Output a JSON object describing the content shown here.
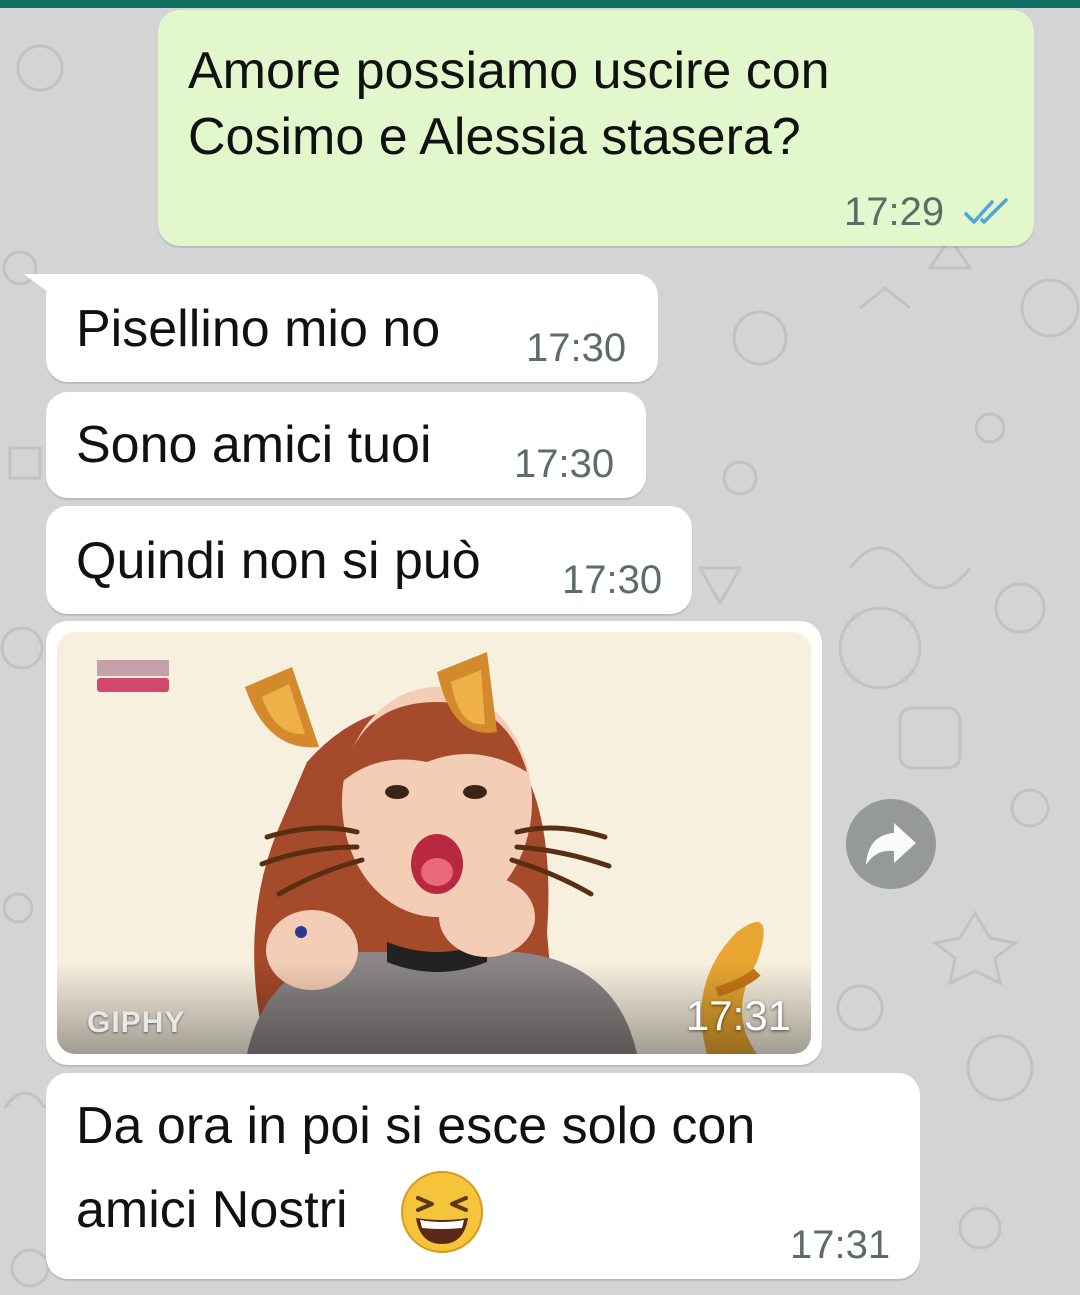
{
  "chat": {
    "messages": [
      {
        "direction": "out",
        "lines": [
          "Amore possiamo uscire con",
          "Cosimo e Alessia stasera?"
        ],
        "time": "17:29",
        "status": "read"
      },
      {
        "direction": "in",
        "text": "Pisellino mio no",
        "time": "17:30"
      },
      {
        "direction": "in",
        "text": "Sono amici tuoi",
        "time": "17:30"
      },
      {
        "direction": "in",
        "text": "Quindi non si può",
        "time": "17:30"
      },
      {
        "direction": "in",
        "type": "gif",
        "source_label": "GIPHY",
        "time": "17:31"
      },
      {
        "direction": "in",
        "lines": [
          "Da ora in poi si esce solo con",
          "amici Nostri"
        ],
        "emoji": "grinning-squinting-face",
        "time": "17:31"
      }
    ]
  },
  "colors": {
    "header_accent": "#0f6e5f",
    "outgoing_bubble": "#e2f7cb",
    "incoming_bubble": "#ffffff",
    "read_ticks": "#4fa3e0",
    "wallpaper": "#d4d4d4"
  },
  "icons": {
    "read_status": "double-check-icon",
    "forward": "forward-arrow-icon"
  }
}
